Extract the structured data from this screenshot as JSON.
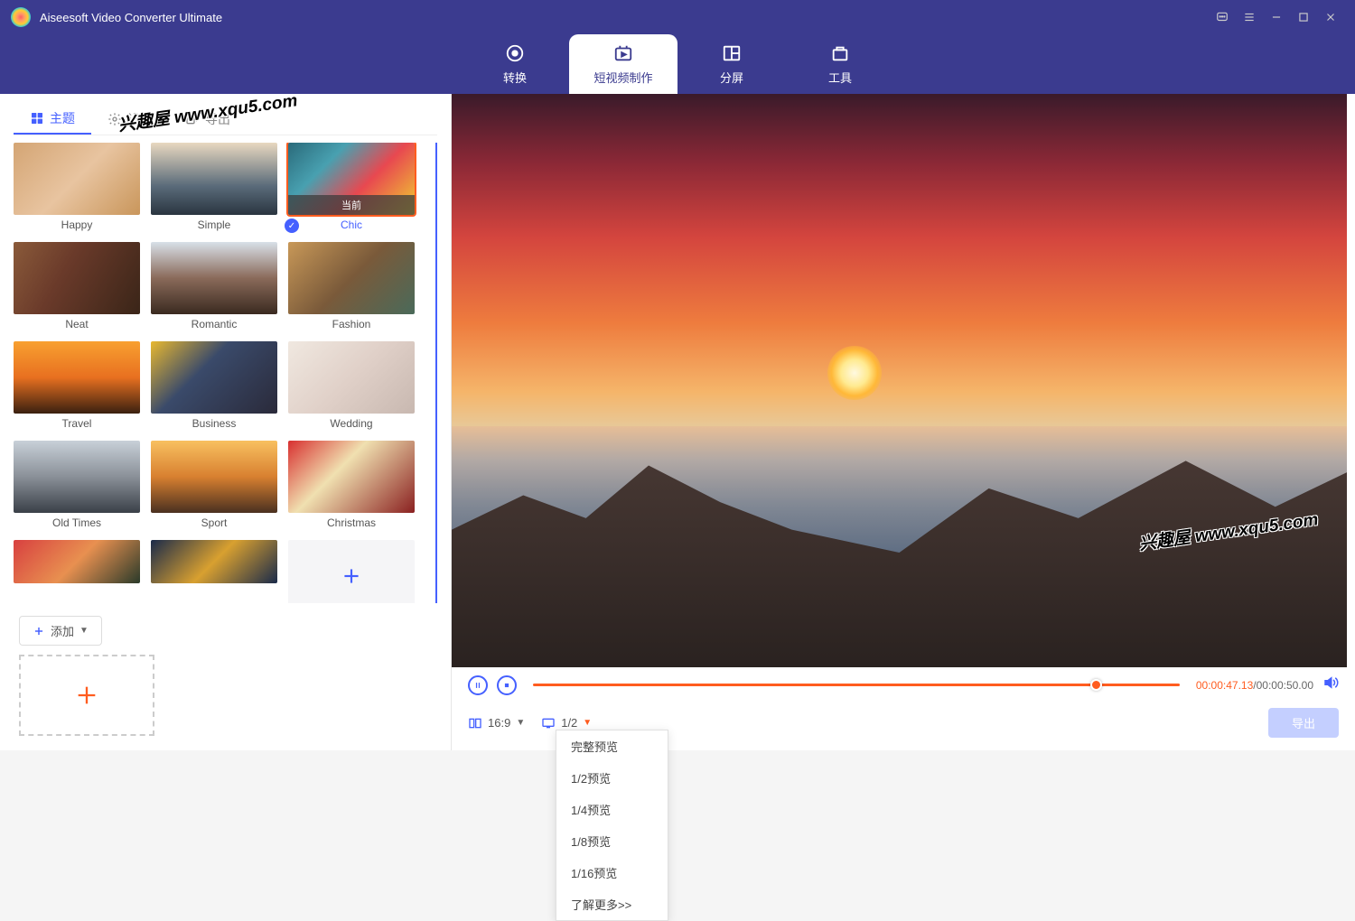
{
  "app_title": "Aiseesoft Video Converter Ultimate",
  "watermark": "兴趣屋 www.xqu5.com",
  "topnav": {
    "convert": "转换",
    "mv": "短视频制作",
    "split": "分屏",
    "tools": "工具"
  },
  "subtabs": {
    "theme": "主题",
    "settings": "设置",
    "export": "导出"
  },
  "themes": [
    {
      "label": "Happy",
      "cls": "t-happy"
    },
    {
      "label": "Simple",
      "cls": "t-simple"
    },
    {
      "label": "Chic",
      "cls": "t-chic",
      "selected": true,
      "current": "当前"
    },
    {
      "label": "Neat",
      "cls": "t-neat"
    },
    {
      "label": "Romantic",
      "cls": "t-romantic"
    },
    {
      "label": "Fashion",
      "cls": "t-fashion"
    },
    {
      "label": "Travel",
      "cls": "t-travel"
    },
    {
      "label": "Business",
      "cls": "t-business"
    },
    {
      "label": "Wedding",
      "cls": "t-wedding"
    },
    {
      "label": "Old Times",
      "cls": "t-oldtimes"
    },
    {
      "label": "Sport",
      "cls": "t-sport"
    },
    {
      "label": "Christmas",
      "cls": "t-christmas"
    },
    {
      "label": "",
      "cls": "t-gift",
      "partial": true
    },
    {
      "label": "",
      "cls": "t-merry",
      "partial": true
    },
    {
      "label": "",
      "add": true
    }
  ],
  "add_button": "添加",
  "player": {
    "time_current": "00:00:47.13",
    "time_total": "/00:00:50.00",
    "aspect": "16:9",
    "zoom": "1/2",
    "export": "导出"
  },
  "dropdown": {
    "full": "完整预览",
    "half": "1/2预览",
    "quarter": "1/4预览",
    "eighth": "1/8预览",
    "sixteenth": "1/16预览",
    "more": "了解更多>>"
  }
}
